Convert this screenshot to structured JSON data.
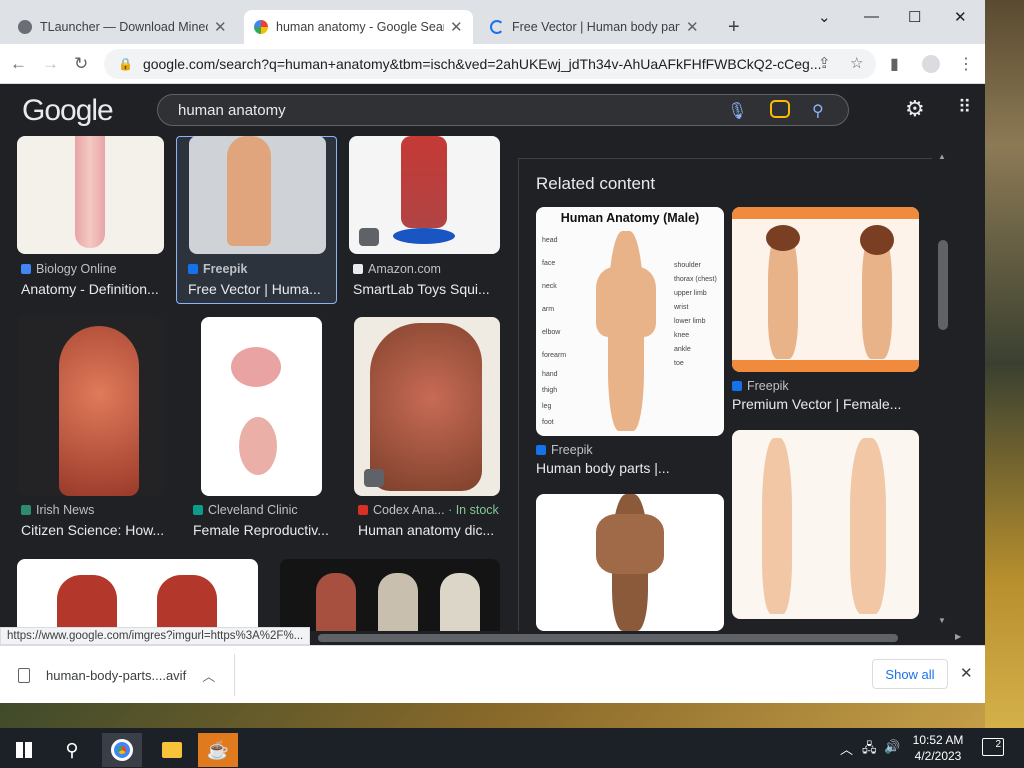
{
  "browser": {
    "tabs": [
      {
        "title": "TLauncher — Download Minecraft",
        "close": "✕"
      },
      {
        "title": "human anatomy - Google Search",
        "close": "✕"
      },
      {
        "title": "Free Vector | Human body parts",
        "close": "✕"
      }
    ],
    "new_tab": "+",
    "url": "google.com/search?q=human+anatomy&tbm=isch&ved=2ahUKEwj_jdTh34v-AhUaAFkFHfFWBCkQ2-cCeg...",
    "status_url": "https://www.google.com/imgres?imgurl=https%3A%2F%..."
  },
  "google": {
    "logo": "Google",
    "query": "human anatomy"
  },
  "results": [
    {
      "source": "Biology Online",
      "caption": "Anatomy - Definition...",
      "source_color": "#4285f4"
    },
    {
      "source": "Freepik",
      "caption": "Free Vector | Huma...",
      "source_color": "#1273eb"
    },
    {
      "source": "Amazon.com",
      "caption": "SmartLab Toys Squi...",
      "source_color": "#ffffff"
    },
    {
      "source": "Irish News",
      "caption": "Citizen Science: How...",
      "source_color": "#2d8c6f"
    },
    {
      "source": "Cleveland Clinic",
      "caption": "Female Reproductiv...",
      "source_color": "#0a9e8a"
    },
    {
      "source": "Codex Ana...",
      "stock": "· In stock",
      "caption": "Human anatomy dic...",
      "source_color": "#d93025"
    }
  ],
  "related": {
    "title": "Related content",
    "items": [
      {
        "source": "Freepik",
        "caption": "Human body parts |...",
        "image_title": "Human Anatomy (Male)"
      },
      {
        "source": "Freepik",
        "caption": "Premium Vector | Female..."
      }
    ],
    "male_labels": [
      "head",
      "face",
      "neck",
      "shoulder",
      "thorax (chest)",
      "arm",
      "elbow",
      "upper limb",
      "forearm",
      "wrist",
      "hand",
      "thigh",
      "lower limb",
      "knee",
      "leg",
      "ankle",
      "foot",
      "toe"
    ]
  },
  "downloads": {
    "file": "human-body-parts....avif",
    "show_all": "Show all"
  },
  "taskbar": {
    "time": "10:52 AM",
    "date": "4/2/2023",
    "notifications": "2"
  }
}
